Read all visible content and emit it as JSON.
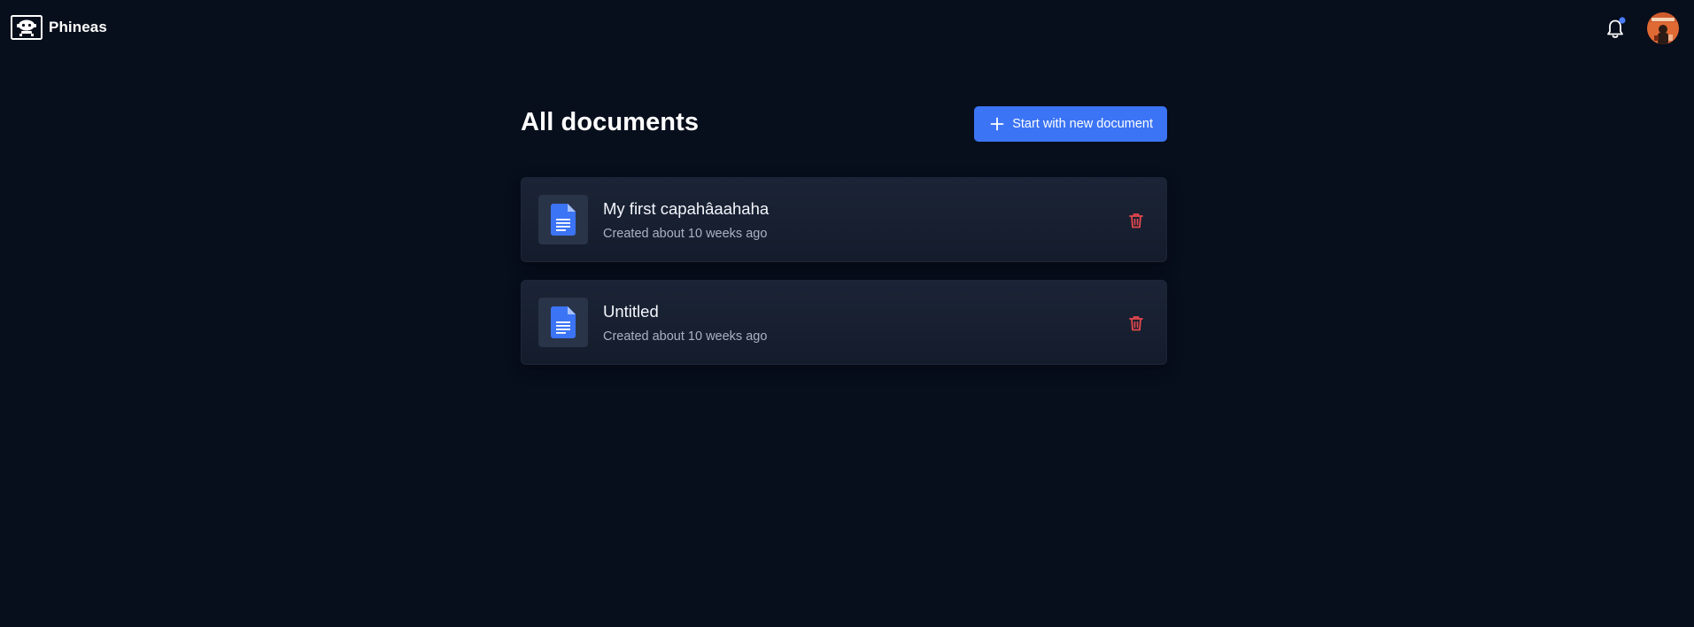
{
  "app": {
    "brand_name": "Phineas",
    "icons": {
      "logo": "robot-logo-icon",
      "notifications": "bell-icon",
      "notification_dot_color": "#4a7cf7"
    }
  },
  "header": {
    "title": "All documents",
    "new_document_label": "Start with new document",
    "new_document_icon": "plus-icon",
    "accent_color": "#3b74f5"
  },
  "documents": [
    {
      "title": "My first capahâaahaha",
      "meta": "Created about 10 weeks ago",
      "icon": "document-icon",
      "action_icon": "trash-icon"
    },
    {
      "title": "Untitled",
      "meta": "Created about 10 weeks ago",
      "icon": "document-icon",
      "action_icon": "trash-icon"
    }
  ],
  "colors": {
    "background": "#070e1c",
    "card": "#1b2436",
    "delete": "#e5484d"
  }
}
